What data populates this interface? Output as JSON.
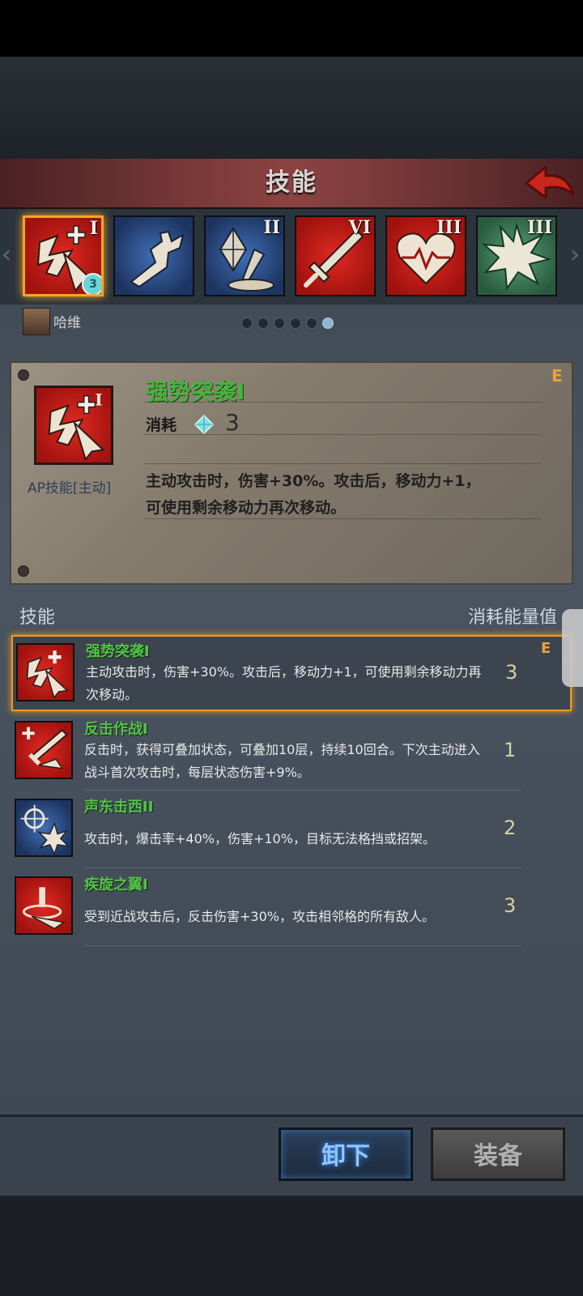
{
  "header": {
    "title": "技能"
  },
  "skill_slots": [
    {
      "rank": "I",
      "cost_badge": "3",
      "color": "red",
      "icon": "dash-attack-icon",
      "selected": true
    },
    {
      "rank": "",
      "color": "blue",
      "icon": "leaping-figure-icon"
    },
    {
      "rank": "II",
      "color": "blue",
      "icon": "crystal-sword-icon"
    },
    {
      "rank": "VI",
      "color": "red",
      "icon": "sword-icon"
    },
    {
      "rank": "III",
      "color": "red",
      "icon": "heartbeat-icon"
    },
    {
      "rank": "III",
      "color": "green",
      "icon": "burst-icon"
    }
  ],
  "character": {
    "name": "哈维"
  },
  "pagination": {
    "total": 6,
    "active_index": 5
  },
  "detail": {
    "name": "强势突袭I",
    "cost_label": "消耗",
    "cost_value": "3",
    "type": "AP技能[主动]",
    "rank_letter": "E",
    "description": "主动攻击时，伤害+30%。攻击后，移动力+1，可使用剩余移动力再次移动。"
  },
  "list": {
    "header_left": "技能",
    "header_right": "消耗能量值",
    "rows": [
      {
        "name": "强势突袭I",
        "desc": "主动攻击时，伤害+30%。攻击后，移动力+1，可使用剩余移动力再次移动。",
        "cost": "3",
        "rank": "E",
        "icon": "dash-attack-icon",
        "color": "red"
      },
      {
        "name": "反击作战I",
        "desc": "反击时，获得可叠加状态，可叠加10层，持续10回合。下次主动进入战斗首次攻击时，每层状态伤害+9%。",
        "cost": "1",
        "rank": "",
        "icon": "counter-attack-icon",
        "color": "red"
      },
      {
        "name": "声东击西II",
        "desc": "攻击时，爆击率+40%，伤害+10%，目标无法格挡或招架。",
        "cost": "2",
        "rank": "",
        "icon": "target-burst-icon",
        "color": "blue"
      },
      {
        "name": "疾旋之翼I",
        "desc": "受到近战攻击后，反击伤害+30%，攻击相邻格的所有敌人。",
        "cost": "3",
        "rank": "",
        "icon": "whirl-wing-icon",
        "color": "red"
      }
    ]
  },
  "buttons": {
    "unequip": "卸下",
    "equip": "装备"
  },
  "colors": {
    "accent_orange": "#f29a1e",
    "skill_name_green": "#55c24a",
    "header_red": "#8b4341"
  }
}
